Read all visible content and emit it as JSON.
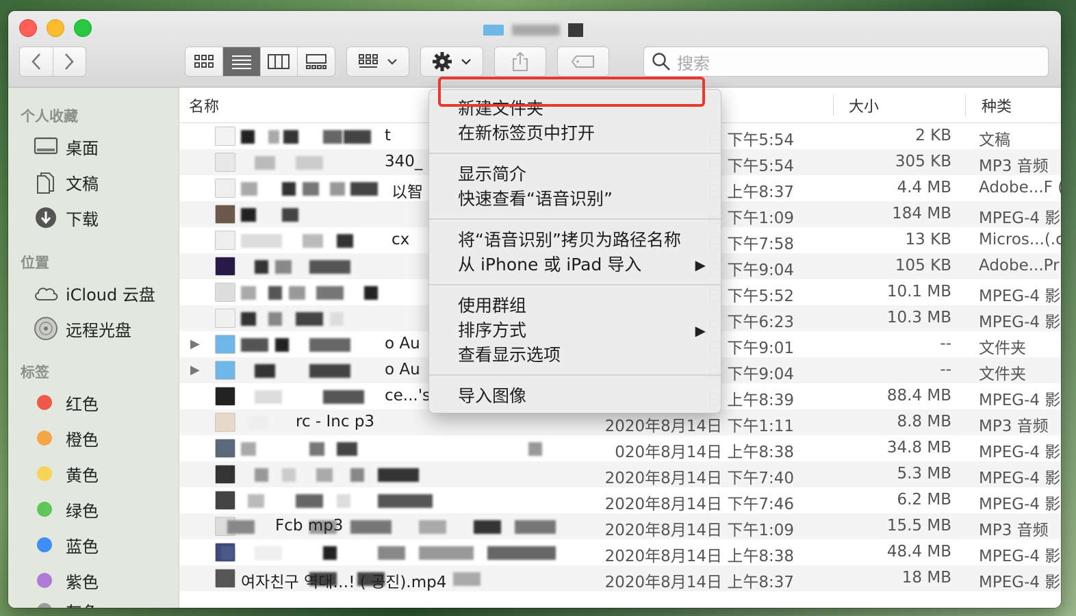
{
  "search": {
    "placeholder": "搜索"
  },
  "sidebar": {
    "favorites_header": "个人收藏",
    "favorites": [
      {
        "label": "桌面",
        "icon": "desktop-icon"
      },
      {
        "label": "文稿",
        "icon": "document-icon"
      },
      {
        "label": "下载",
        "icon": "download-icon"
      }
    ],
    "locations_header": "位置",
    "locations": [
      {
        "label": "iCloud 云盘",
        "icon": "cloud-icon"
      },
      {
        "label": "远程光盘",
        "icon": "disc-icon"
      }
    ],
    "tags_header": "标签",
    "tags": [
      {
        "label": "红色",
        "color": "#f0584c"
      },
      {
        "label": "橙色",
        "color": "#f5a54a"
      },
      {
        "label": "黄色",
        "color": "#f7d358"
      },
      {
        "label": "绿色",
        "color": "#5fc75a"
      },
      {
        "label": "蓝色",
        "color": "#3d8ef5"
      },
      {
        "label": "紫色",
        "color": "#b27ad8"
      },
      {
        "label": "灰色",
        "color": "#9b9b9b"
      }
    ]
  },
  "columns": {
    "name": "名称",
    "size": "大小",
    "kind": "种类"
  },
  "rows": [
    {
      "name": "t",
      "date": "日 下午5:54",
      "size": "2 KB",
      "kind": "文稿"
    },
    {
      "name": "340_",
      "date": "日 下午5:54",
      "size": "305 KB",
      "kind": "MP3 音频"
    },
    {
      "name": "以智",
      "date": "日 上午8:37",
      "size": "4.4 MB",
      "kind": "Adobe...F ("
    },
    {
      "name": "",
      "date": "日 下午1:09",
      "size": "184 MB",
      "kind": "MPEG-4 影"
    },
    {
      "name": "cx",
      "date": "日 下午7:58",
      "size": "13 KB",
      "kind": "Micros...(.c"
    },
    {
      "name": "",
      "date": "日 下午9:04",
      "size": "105 KB",
      "kind": "Adobe...Pr"
    },
    {
      "name": "",
      "date": "日 下午5:52",
      "size": "10.1 MB",
      "kind": "MPEG-4 影"
    },
    {
      "name": "",
      "date": "日 下午6:23",
      "size": "10.3 MB",
      "kind": "MPEG-4 影"
    },
    {
      "name": "o Au",
      "date": "日 下午9:01",
      "size": "--",
      "kind": "文件夹"
    },
    {
      "name": "o Au",
      "date": "日 下午9:04",
      "size": "--",
      "kind": "文件夹"
    },
    {
      "name": "ce...'s",
      "date": "日 上午8:39",
      "size": "88.4 MB",
      "kind": "MPEG-4 影"
    },
    {
      "name": "rc          - Inc     p3",
      "date": "2020年8月14日 下午1:11",
      "size": "8.8 MB",
      "kind": "MP3 音频"
    },
    {
      "name": "",
      "date": "020年8月14日 上午8:38",
      "size": "34.8 MB",
      "kind": "MPEG-4 影"
    },
    {
      "name": "",
      "date": "2020年8月14日 下午7:40",
      "size": "5.3 MB",
      "kind": "MPEG-4 影"
    },
    {
      "name": "",
      "date": "2020年8月14日 下午7:46",
      "size": "6.2 MB",
      "kind": "MPEG-4 影"
    },
    {
      "name": "Fcb                              mp3",
      "date": "2020年8月14日 下午1:09",
      "size": "15.5 MB",
      "kind": "MP3 音频"
    },
    {
      "name": "",
      "date": "2020年8月14日 上午8:38",
      "size": "48.4 MB",
      "kind": "MPEG-4 影"
    },
    {
      "name": "여자친구      역대…! (       공진).mp4",
      "date": "2020年8月14日 上午8:37",
      "size": "18 MB",
      "kind": "MPEG-4 影"
    }
  ],
  "context_menu": {
    "new_folder": "新建文件夹",
    "open_in_new_tab": "在新标签页中打开",
    "get_info": "显示简介",
    "quick_look": "快速查看“语音识别”",
    "copy_as_path": "将“语音识别”拷贝为路径名称",
    "import_from_iphone": "从 iPhone 或 iPad 导入",
    "use_groups": "使用群组",
    "sort_by": "排序方式",
    "show_view_options": "查看显示选项",
    "import_images": "导入图像"
  },
  "highlight_color": "#e8392e"
}
